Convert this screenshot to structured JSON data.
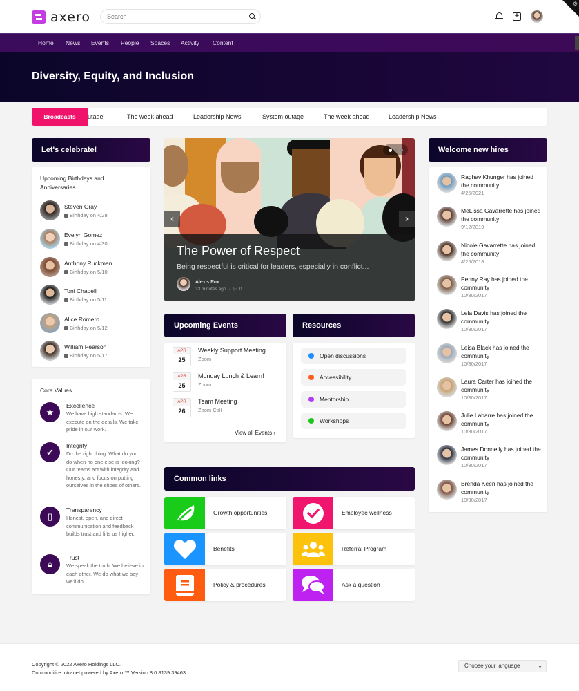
{
  "app": {
    "logo_text": "axero"
  },
  "search": {
    "placeholder": "Search"
  },
  "top_icons": [
    "bell-icon",
    "add-box-icon",
    "user-avatar"
  ],
  "nav": [
    "Home",
    "News",
    "Events",
    "People",
    "Spaces",
    "Activity",
    "Content"
  ],
  "hero": {
    "title": "Diversity, Equity, and Inclusion"
  },
  "tabs": {
    "active": "Broadcasts",
    "items": [
      "outage",
      "The week ahead",
      "Leadership News",
      "System outage",
      "The week ahead",
      "Leadership News"
    ]
  },
  "celebrate": {
    "header": "Let's celebrate!",
    "title": "Upcoming Birthdays and Anniversaries",
    "people": [
      {
        "name": "Steven Gray",
        "event": "Birthday on 4/28"
      },
      {
        "name": "Evelyn Gomez",
        "event": "Birthday on 4/30"
      },
      {
        "name": "Anthony Ruckman",
        "event": "Birthday on 5/10"
      },
      {
        "name": "Toni Chapell",
        "event": "Birthday on 5/11"
      },
      {
        "name": "Alice Romero",
        "event": "Birthday on 5/12"
      },
      {
        "name": "William Pearson",
        "event": "Birthday on 5/17"
      }
    ]
  },
  "core_values": {
    "title": "Core Values",
    "items": [
      {
        "name": "Excellence",
        "icon": "star-icon",
        "desc": "We have high standards. We execute on the details. We take pride in our work."
      },
      {
        "name": "Integrity",
        "icon": "shield-check-icon",
        "desc": "Do the right thing: What do you do when no one else is looking? Our teams act with integrity and honesty, and focus on putting ourselves in the shoes of others."
      },
      {
        "name": "Transparency",
        "icon": "door-icon",
        "desc": "Honest, open, and direct communication and feedback builds trust and lifts us higher."
      },
      {
        "name": "Trust",
        "icon": "lock-icon",
        "desc": "We speak the truth. We believe in each other. We do what we say we'll do."
      }
    ]
  },
  "carousel": {
    "title": "The Power of Respect",
    "excerpt": "Being respectful is critical for leaders, especially in conflict...",
    "author": "Alexis Fox",
    "time": "33 minutes ago",
    "comments": "0",
    "slides": 3,
    "active_slide": 1,
    "prev": "‹",
    "next": "›"
  },
  "events": {
    "header": "Upcoming Events",
    "items": [
      {
        "month": "APR",
        "day": "25",
        "title": "Weekly Support Meeting",
        "location": "Zoom"
      },
      {
        "month": "APR",
        "day": "25",
        "title": "Monday Lunch & Learn!",
        "location": "Zoom"
      },
      {
        "month": "APR",
        "day": "26",
        "title": "Team Meeting",
        "location": "Zoom Call"
      }
    ],
    "view_all": "View all Events ›"
  },
  "resources": {
    "header": "Resources",
    "items": [
      {
        "label": "Open discussions",
        "color": "#1e90ff"
      },
      {
        "label": "Accessibility",
        "color": "#ff5a1f"
      },
      {
        "label": "Mentorship",
        "color": "#b23cf0"
      },
      {
        "label": "Workshops",
        "color": "#1fc41f"
      }
    ]
  },
  "common_links": {
    "header": "Common links",
    "items": [
      {
        "label": "Growth opportunities",
        "color": "#19cc19",
        "icon": "leaf-icon"
      },
      {
        "label": "Employee wellness",
        "color": "#f0166e",
        "icon": "check-circle-icon"
      },
      {
        "label": "Benefits",
        "color": "#1a94ff",
        "icon": "heart-icon"
      },
      {
        "label": "Referral Program",
        "color": "#fcc20c",
        "icon": "people-icon"
      },
      {
        "label": "Policy & procedures",
        "color": "#ff5c11",
        "icon": "book-icon"
      },
      {
        "label": "Ask a question",
        "color": "#bd22f0",
        "icon": "chat-icon"
      }
    ]
  },
  "new_hires": {
    "header": "Welcome new hires",
    "joined_text": "has joined the community",
    "items": [
      {
        "name": "Raghav Khunger",
        "date": "4/25/2021"
      },
      {
        "name": "MeLissa Gavarrette",
        "date": "9/12/2019"
      },
      {
        "name": "Nicole Gavarrette",
        "date": "4/25/2018"
      },
      {
        "name": "Penny Ray",
        "date": "10/30/2017"
      },
      {
        "name": "Lela Davis",
        "date": "10/30/2017"
      },
      {
        "name": "Leisa Black",
        "date": "10/30/2017"
      },
      {
        "name": "Laura Carter",
        "date": "10/30/2017"
      },
      {
        "name": "Julie Labarre",
        "date": "10/30/2017"
      },
      {
        "name": "James Donnelly",
        "date": "10/30/2017"
      },
      {
        "name": "Brenda Keen",
        "date": "10/30/2017"
      }
    ]
  },
  "footer": {
    "copyright": "Copyright © 2022 Axero Holdings LLC.",
    "powered": "Communifire Intranet powered by Axero ™ Version 8.0.8139.39463",
    "language": "Choose your language"
  }
}
